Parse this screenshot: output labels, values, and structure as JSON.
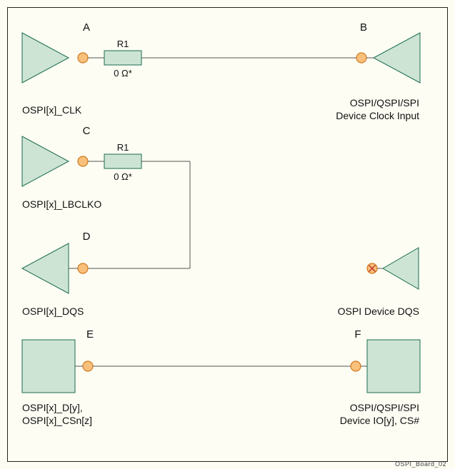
{
  "diagram": {
    "footer": "OSPI_Board_02",
    "nodes": {
      "A": "A",
      "B": "B",
      "C": "C",
      "D": "D",
      "E": "E",
      "F": "F"
    },
    "resistors": {
      "r1_top_label": "R1",
      "r1_top_value": "0 Ω*",
      "r1_mid_label": "R1",
      "r1_mid_value": "0 Ω*"
    },
    "labels": {
      "clk": "OSPI[x]_CLK",
      "device_clock_l1": "OSPI/QSPI/SPI",
      "device_clock_l2": "Device Clock Input",
      "lbclko": "OSPI[x]_LBCLKO",
      "dqs": "OSPI[x]_DQS",
      "device_dqs": "OSPI Device DQS",
      "dy_l1": "OSPI[x]_D[y],",
      "dy_l2": "OSPI[x]_CSn[z]",
      "io_l1": "OSPI/QSPI/SPI",
      "io_l2": "Device IO[y], CS#"
    }
  },
  "colors": {
    "shape_fill": "#cde4d4",
    "shape_stroke": "#1b6d52",
    "pin_fill": "#f9c07b",
    "pin_stroke": "#d07a1f",
    "wire": "#555"
  }
}
